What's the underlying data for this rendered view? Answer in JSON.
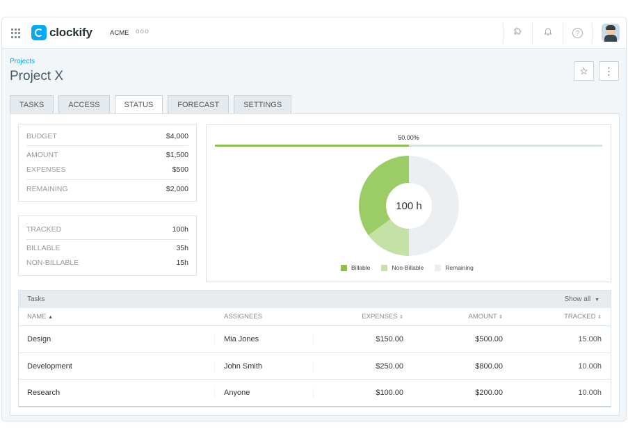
{
  "app": {
    "name": "clockify",
    "workspace": "ACME",
    "workspace_more": "ooo"
  },
  "header": {
    "breadcrumb": "Projects",
    "title": "Project X",
    "star_icon": "☆",
    "more_icon": "⋮"
  },
  "tabs": [
    {
      "label": "TASKS"
    },
    {
      "label": "ACCESS"
    },
    {
      "label": "STATUS",
      "active": true
    },
    {
      "label": "FORECAST"
    },
    {
      "label": "SETTINGS"
    }
  ],
  "budget": {
    "budget_label": "BUDGET",
    "budget_value": "$4,000",
    "amount_label": "AMOUNT",
    "amount_value": "$1,500",
    "expenses_label": "EXPENSES",
    "expenses_value": "$500",
    "remaining_label": "REMAINING",
    "remaining_value": "$2,000"
  },
  "time": {
    "tracked_label": "TRACKED",
    "tracked_value": "100h",
    "billable_label": "BILLABLE",
    "billable_value": "35h",
    "nonbillable_label": "NON-BILLABLE",
    "nonbillable_value": "15h"
  },
  "status": {
    "percent_label": "50.00%",
    "progress": 0.5,
    "center_label": "100 h"
  },
  "chart_data": {
    "type": "pie",
    "categories": [
      "Billable",
      "Non-Billable",
      "Remaining"
    ],
    "values": [
      35,
      15,
      50
    ],
    "colors": [
      "#9ccc65",
      "#c5e1a5",
      "#eceff1"
    ],
    "donut": true
  },
  "tasks_table": {
    "title": "Tasks",
    "show_all": "Show all",
    "columns": [
      "NAME",
      "ASSIGNEES",
      "EXPENSES",
      "AMOUNT",
      "TRACKED"
    ],
    "rows": [
      {
        "name": "Design",
        "assignee": "Mia Jones",
        "expenses": "$150.00",
        "amount": "$500.00",
        "tracked": "15.00h"
      },
      {
        "name": "Development",
        "assignee": "John Smith",
        "expenses": "$250.00",
        "amount": "$800.00",
        "tracked": "10.00h"
      },
      {
        "name": "Research",
        "assignee": "Anyone",
        "expenses": "$100.00",
        "amount": "$200.00",
        "tracked": "10.00h"
      }
    ]
  },
  "icons": {
    "apps": "grid-icon",
    "extension": "puzzle-icon",
    "notifications": "bell-icon",
    "help": "help-icon",
    "sort": "sort-icon",
    "dropdown": "caret-down-icon"
  },
  "colors": {
    "accent": "#03a9f4",
    "billable": "#9ccc65",
    "non_billable": "#c5e1a5",
    "remaining": "#eceff1",
    "progress": "#8bc34a"
  }
}
